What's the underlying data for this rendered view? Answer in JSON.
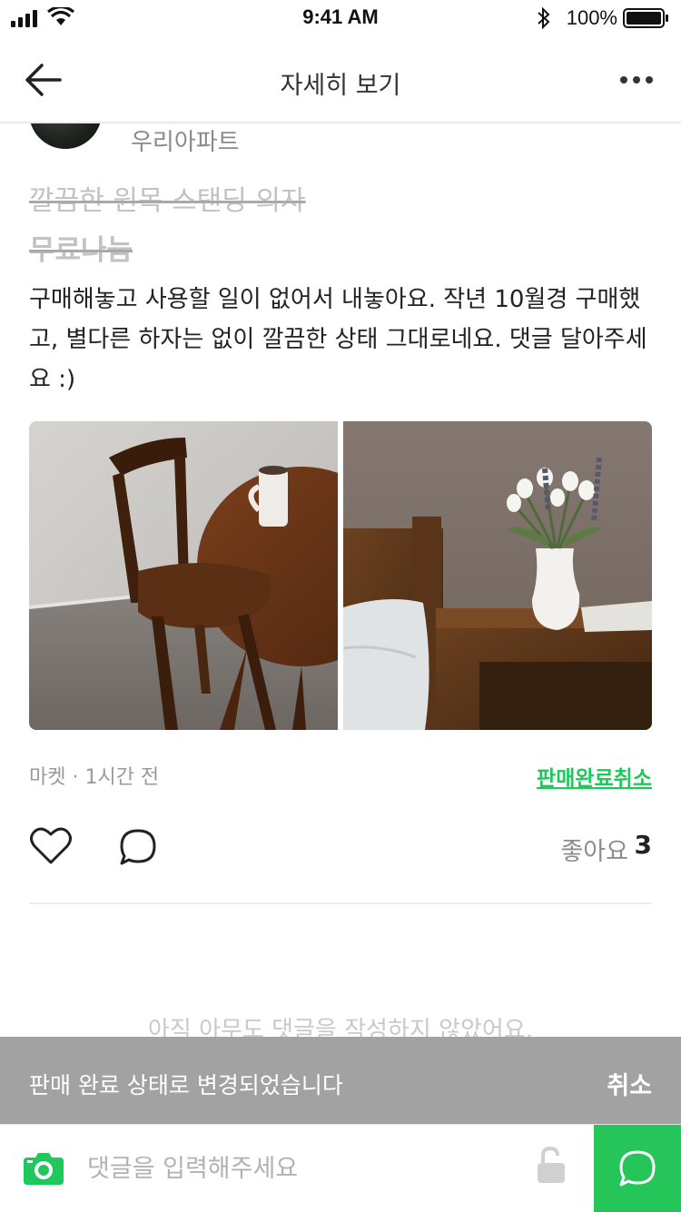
{
  "status_bar": {
    "time": "9:41 AM",
    "battery": "100%"
  },
  "nav": {
    "title": "자세히 보기"
  },
  "post": {
    "location": "우리아파트",
    "title": "깔끔한 원목 스탠딩 의자",
    "price": "무료나눔",
    "description": "구매해놓고 사용할 일이 없어서 내놓아요. 작년 10월경 구매했고, 별다른 하자는 없이 깔끔한 상태 그대로네요. 댓글 달아주세요 :)",
    "meta": "마켓 · 1시간 전",
    "cancel_sold_label": "판매완료취소",
    "like_label": "좋아요",
    "like_count": "3",
    "no_comments": "아직 아무도 댓글을 작성하지 않았어요."
  },
  "toast": {
    "message": "판매 완료 상태로 변경되었습니다",
    "action": "취소"
  },
  "comment_bar": {
    "placeholder": "댓글을 입력해주세요"
  },
  "colors": {
    "accent": "#1ec85a",
    "send_bg": "#25c55a",
    "toast_bg": "#a2a2a2"
  }
}
